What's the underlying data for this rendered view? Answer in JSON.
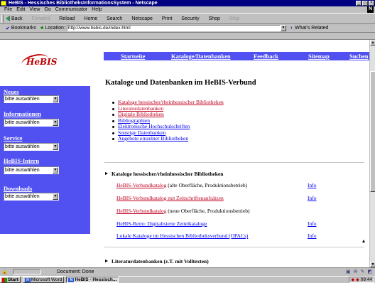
{
  "window": {
    "title": "HeBIS - Hessisches BibliotheksInformationsSystem - Netscape",
    "controls": [
      "_",
      "□",
      "×"
    ]
  },
  "menu": [
    "File",
    "Edit",
    "View",
    "Go",
    "Communicator",
    "Help"
  ],
  "toolbar": {
    "buttons": [
      {
        "label": "Back",
        "enabled": true
      },
      {
        "label": "Forward",
        "enabled": false
      },
      {
        "label": "Reload",
        "enabled": true
      },
      {
        "label": "Home",
        "enabled": true
      },
      {
        "label": "Search",
        "enabled": true
      },
      {
        "label": "Netscape",
        "enabled": true
      },
      {
        "label": "Print",
        "enabled": true
      },
      {
        "label": "Security",
        "enabled": true
      },
      {
        "label": "Shop",
        "enabled": true
      },
      {
        "label": "Stop",
        "enabled": false
      }
    ]
  },
  "location": {
    "bookmarks_label": "Bookmarks",
    "location_label": "Location:",
    "url": "http://www.hebis.de/index.html",
    "related_label": "What's Related"
  },
  "page": {
    "logo": "HeBIS",
    "topnav": [
      "Startseite",
      "Kataloge/Datenbanken",
      "Feedback",
      "Sitemap",
      "Suchen"
    ],
    "sidebar": [
      {
        "heading": "Neues",
        "select": "bitte auswählen"
      },
      {
        "heading": "Informationen",
        "select": "bitte auswählen"
      },
      {
        "heading": "Service",
        "select": "bitte auswählen"
      },
      {
        "heading": "HeBIS-Intern",
        "select": "bitte auswählen"
      },
      {
        "heading": "Downloads",
        "select": "bitte auswählen"
      }
    ],
    "title": "Kataloge und Datenbanken im HeBIS-Verbund",
    "bullets": [
      {
        "label": "Kataloge hessischer/rheinhessischer Bibliotheken",
        "visited": true
      },
      {
        "label": "Literaturdatenbanken",
        "visited": true
      },
      {
        "label": "Digitale Bibliotheken",
        "visited": true
      },
      {
        "label": "Bibliographien",
        "visited": false
      },
      {
        "label": "Elektronische Hochschulschriften",
        "visited": false
      },
      {
        "label": "Sonstige Datenbanken",
        "visited": false
      },
      {
        "label": "Angebote einzelner Bibliotheken",
        "visited": false
      }
    ],
    "section1": {
      "heading": "Kataloge hessischer/rheinhessischer Bibliotheken",
      "rows": [
        {
          "link": "HeBIS-Verbundkatalog",
          "note": " (alte Oberfläche, Produktionsbetrieb)",
          "info": "Info",
          "color": "red"
        },
        {
          "link": "HeBIS-Verbundkatalog mit Zeitschriftenaufsätzen",
          "note": "",
          "info": "Info",
          "color": "red"
        },
        {
          "link": "HeBIS-Verbundkatalog",
          "note": " (neue Oberfläche, Produktionsbetrieb)",
          "info": "",
          "color": "red"
        },
        {
          "link": "HeBIS-Retro: Digitalisierte Zettelkataloge",
          "note": "",
          "info": "Info",
          "color": "blue"
        },
        {
          "link": "Lokale Kataloge im Hessischen Bibliotheksverbund (OPACs)",
          "note": "",
          "info": "Info",
          "color": "blue"
        }
      ]
    },
    "section2": {
      "heading": "Literaturdatenbanken (z.T. mit Volltexten)"
    }
  },
  "status": {
    "text": "Document: Done"
  },
  "taskbar": {
    "start": "Start",
    "tasks": [
      {
        "label": "Microsoft Word",
        "active": false
      },
      {
        "label": "HeBIS - Hessisch...",
        "active": true
      }
    ],
    "clock": "09:44"
  }
}
